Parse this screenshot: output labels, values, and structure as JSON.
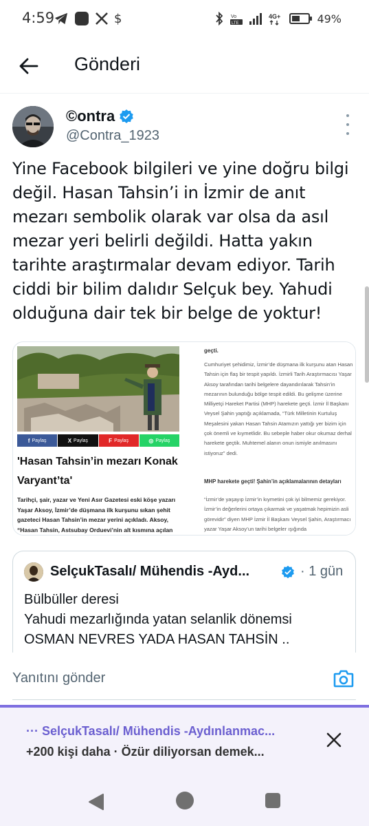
{
  "status_bar": {
    "time": "4:59",
    "left_icons": [
      "telegram-icon",
      "app-square-icon",
      "x-icon",
      "dollar-icon"
    ],
    "right_icons": [
      "bluetooth-icon",
      "volte-icon",
      "signal-icon",
      "4g-icon",
      "battery-icon"
    ],
    "battery_percent": "49%",
    "battery_level": 0.49
  },
  "header": {
    "title": "Gönderi"
  },
  "tweet": {
    "author_name": "©ontra",
    "author_handle": "@Contra_1923",
    "verified": true,
    "text": "Yine Facebook bilgileri ve yine doğru bilgi değil. Hasan Tahsin’i in İzmir de anıt mezarı sembolik olarak var olsa da asıl mezar yeri belirli değildi. Hatta yakın tarihte araştırmalar devam ediyor. Tarih ciddi bir bilim dalıdır Selçuk bey. Yahudi olduğuna dair tek bir belge de yoktur!"
  },
  "media": {
    "share_buttons": [
      {
        "icon": "facebook-icon",
        "label": "Paylaş",
        "color": "#3b5998"
      },
      {
        "icon": "x-icon",
        "label": "Paylaş",
        "color": "#111111"
      },
      {
        "icon": "flipboard-icon",
        "label": "Paylaş",
        "color": "#e12828"
      },
      {
        "icon": "whatsapp-icon",
        "label": "Paylaş",
        "color": "#25d366"
      }
    ],
    "headline": "'Hasan Tahsin’in mezarı Konak Varyant’ta'",
    "body": "Tarihçi, şair, yazar ve Yeni Asır Gazetesi eski köşe yazarı Yaşar Aksoy, İzmir’de düşmana ilk kurşunu sıkan şehit gazeteci Hasan Tahsin’in mezar yerini açıkladı. Aksoy, “Hasan Tahsin, Astsubay Orduevi’nin alt kısmına açılan toplu mezara gömüldü” dedi",
    "article_heading": "geçti.",
    "article_p1": "Cumhuriyet şehidimiz, İzmir’de düşmana ilk kurşunu atan Hasan Tahsin için flaş bir tespit yapıldı. İzmirli Tarih Araştırmacısı Yaşar Aksoy tarafından tarihi belgelere dayandırılarak Tahsin’in mezarının bulunduğu bölge tespit edildi. Bu gelişme üzerine Milliyetçi Hareket Partisi (MHP) harekete geçti. İzmir İl Başkanı Veysel Şahin yaptığı açıklamada, “Türk Milletinin Kurtuluş Meşalesini yakan Hasan Tahsin Atamızın yattığı yer bizim için çok önemli ve kıymetlidir. Bu sebeple haber okur okumaz derhal harekete geçtik. Muhtemel alanın onun ismiyle anılmasını istiyoruz” dedi.",
    "article_sub": "MHP harekete geçti! Şahin’in açıklamalarının detayları",
    "article_p2": "“İzmir’de yaşayıp İzmir’in kıymetini çok iyi bilmemiz gerekiyor. İzmir’in değerlerini ortaya çıkarmak ve yaşatmak hepimizin asli görevidir” diyen MHP İzmir İl Başkanı Veysel Şahin, Araştırmacı yazar Yaşar Aksoy’un tarihi belgeler ışığında"
  },
  "quote": {
    "author_name": "SelçukTasalı/ Mühendis -Ayd...",
    "verified": true,
    "time": "· 1 gün",
    "text_line1": "Bülbüller deresi",
    "text_line2": "Yahudi mezarlığında yatan selanlik dönemsi",
    "text_line3": "OSMAN NEVRES YADA HASAN TAHSİN .."
  },
  "reply": {
    "placeholder": "Yanıtını gönder",
    "camera_icon": "camera-icon"
  },
  "preview": {
    "title": "··· SelçukTasalı/ Mühendis -Aydınlanmac...",
    "subtitle": "+200 kişi daha · Özür diliyorsan demek..."
  },
  "colors": {
    "verified": "#1d9bf0",
    "link_purple": "#6b5fd0",
    "accent_line": "#7e6fe0",
    "camera": "#1d9bf0"
  }
}
